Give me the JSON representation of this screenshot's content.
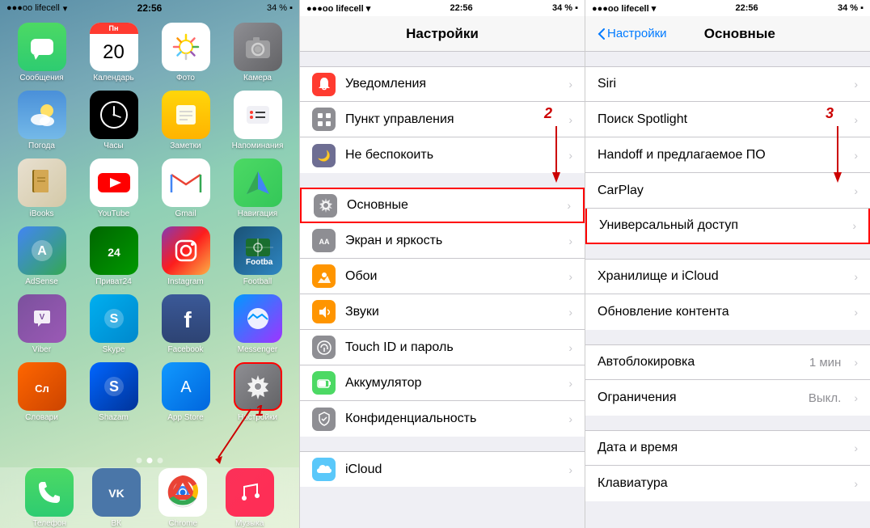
{
  "phone1": {
    "status": {
      "carrier": "●●●oo lifecell",
      "wifi": "▾",
      "time": "22:56",
      "battery": "34 %"
    },
    "apps": [
      {
        "id": "messages",
        "label": "Сообщения",
        "bg": "bg-messages",
        "icon": "💬"
      },
      {
        "id": "calendar",
        "label": "Календарь",
        "bg": "bg-calendar",
        "icon": "cal",
        "day": "Пн",
        "num": "20"
      },
      {
        "id": "photos",
        "label": "Фото",
        "bg": "bg-photos",
        "icon": "🌅"
      },
      {
        "id": "camera",
        "label": "Камера",
        "bg": "bg-camera",
        "icon": "📷"
      },
      {
        "id": "weather",
        "label": "Погода",
        "bg": "bg-weather",
        "icon": "🌤"
      },
      {
        "id": "clock",
        "label": "Часы",
        "bg": "bg-clock",
        "icon": "🕐"
      },
      {
        "id": "notes",
        "label": "Заметки",
        "bg": "bg-notes",
        "icon": "📝"
      },
      {
        "id": "reminders",
        "label": "Напоминания",
        "bg": "bg-reminders",
        "icon": "📋"
      },
      {
        "id": "ibooks",
        "label": "iBooks",
        "bg": "bg-ibooks",
        "icon": "📚"
      },
      {
        "id": "youtube",
        "label": "YouTube",
        "bg": "bg-youtube",
        "icon": "▶"
      },
      {
        "id": "gmail",
        "label": "Gmail",
        "bg": "bg-gmail",
        "icon": "M"
      },
      {
        "id": "navigation",
        "label": "Навигация",
        "bg": "bg-maps",
        "icon": "🗺"
      },
      {
        "id": "adsense",
        "label": "AdSense",
        "bg": "bg-adsense",
        "icon": "A"
      },
      {
        "id": "privat24",
        "label": "Приват24",
        "bg": "bg-privat",
        "icon": "24"
      },
      {
        "id": "instagram",
        "label": "Instagram",
        "bg": "bg-instagram",
        "icon": "📷"
      },
      {
        "id": "football",
        "label": "Football",
        "bg": "bg-football",
        "icon": "⚽"
      },
      {
        "id": "viber",
        "label": "Viber",
        "bg": "bg-viber",
        "icon": "📞"
      },
      {
        "id": "skype",
        "label": "Skype",
        "bg": "bg-skype",
        "icon": "S"
      },
      {
        "id": "facebook",
        "label": "Facebook",
        "bg": "bg-facebook",
        "icon": "f"
      },
      {
        "id": "messenger",
        "label": "Messenger",
        "bg": "bg-messenger",
        "icon": "💬"
      },
      {
        "id": "slovari",
        "label": "Словари",
        "bg": "bg-slovari",
        "icon": "Сл"
      },
      {
        "id": "shazam",
        "label": "Shazam",
        "bg": "bg-shazam",
        "icon": "S"
      },
      {
        "id": "appstore",
        "label": "App Store",
        "bg": "bg-appstore",
        "icon": "A"
      },
      {
        "id": "settings",
        "label": "Настройки",
        "bg": "bg-settings-red",
        "icon": "⚙",
        "highlighted": true
      }
    ],
    "dock": [
      {
        "id": "phone",
        "label": "Телефон",
        "bg": "bg-messages",
        "icon": "📞",
        "color": "#4cd964"
      },
      {
        "id": "vk",
        "label": "ВК",
        "bg": "bg-skype",
        "icon": "VK",
        "color": "#4a76a8"
      },
      {
        "id": "chrome",
        "label": "Chrome",
        "bg": "bg-youtube",
        "icon": "C",
        "color": "#fff"
      },
      {
        "id": "music",
        "label": "Музыка",
        "bg": "bg-youtube",
        "icon": "▶",
        "color": "#ff3b30"
      }
    ]
  },
  "phone2": {
    "status": {
      "carrier": "●●●oo lifecell",
      "wifi": "▾",
      "time": "22:56",
      "battery": "34 %"
    },
    "title": "Настройки",
    "groups": [
      {
        "items": [
          {
            "id": "notifications",
            "icon": "🔴",
            "iconBg": "#ff3b30",
            "label": "Уведомления",
            "hasChevron": true
          },
          {
            "id": "control",
            "icon": "⊟",
            "iconBg": "#8e8e93",
            "label": "Пункт управления",
            "hasChevron": true
          },
          {
            "id": "donotdisturb",
            "icon": "🌙",
            "iconBg": "#6e6e93",
            "label": "Не беспокоить",
            "hasChevron": true
          }
        ]
      },
      {
        "items": [
          {
            "id": "general",
            "icon": "⚙",
            "iconBg": "#8e8e93",
            "label": "Основные",
            "hasChevron": true,
            "highlighted": true
          },
          {
            "id": "display",
            "icon": "AA",
            "iconBg": "#8e8e93",
            "label": "Экран и яркость",
            "hasChevron": true
          },
          {
            "id": "wallpaper",
            "icon": "🌸",
            "iconBg": "#ff9500",
            "label": "Обои",
            "hasChevron": true
          },
          {
            "id": "sounds",
            "icon": "🔔",
            "iconBg": "#ff9500",
            "label": "Звуки",
            "hasChevron": true
          },
          {
            "id": "touchid",
            "icon": "👆",
            "iconBg": "#8e8e93",
            "label": "Touch ID и пароль",
            "hasChevron": true
          },
          {
            "id": "battery",
            "icon": "🔋",
            "iconBg": "#4cd964",
            "label": "Аккумулятор",
            "hasChevron": true
          },
          {
            "id": "privacy",
            "icon": "🤚",
            "iconBg": "#8e8e93",
            "label": "Конфиденциальность",
            "hasChevron": true
          }
        ]
      },
      {
        "items": [
          {
            "id": "icloud",
            "icon": "☁",
            "iconBg": "#5ac8fa",
            "label": "iCloud",
            "hasChevron": true
          }
        ]
      }
    ],
    "annotation2": "2"
  },
  "phone3": {
    "status": {
      "carrier": "●●●oo lifecell",
      "wifi": "▾",
      "time": "22:56",
      "battery": "34 %"
    },
    "backLabel": "Настройки",
    "title": "Основные",
    "groups": [
      {
        "items": [
          {
            "id": "siri",
            "label": "Siri",
            "hasChevron": true,
            "value": ""
          },
          {
            "id": "spotlight",
            "label": "Поиск Spotlight",
            "hasChevron": true
          },
          {
            "id": "handoff",
            "label": "Handoff и предлагаемое ПО",
            "hasChevron": true
          },
          {
            "id": "carplay",
            "label": "CarPlay",
            "hasChevron": true
          },
          {
            "id": "accessibility",
            "label": "Универсальный доступ",
            "hasChevron": true,
            "highlighted": true
          }
        ]
      },
      {
        "items": [
          {
            "id": "storage",
            "label": "Хранилище и iCloud",
            "hasChevron": true
          },
          {
            "id": "bgrefresh",
            "label": "Обновление контента",
            "hasChevron": true
          }
        ]
      },
      {
        "items": [
          {
            "id": "autolock",
            "label": "Автоблокировка",
            "hasChevron": true,
            "value": "1 мин"
          },
          {
            "id": "restrictions",
            "label": "Ограничения",
            "hasChevron": true,
            "value": "Выкл."
          }
        ]
      },
      {
        "items": [
          {
            "id": "datetime",
            "label": "Дата и время",
            "hasChevron": true
          },
          {
            "id": "keyboard",
            "label": "Клавиатура",
            "hasChevron": true
          }
        ]
      }
    ],
    "annotation3": "3"
  },
  "annotations": {
    "num1": "1",
    "num2": "2",
    "num3": "3"
  }
}
